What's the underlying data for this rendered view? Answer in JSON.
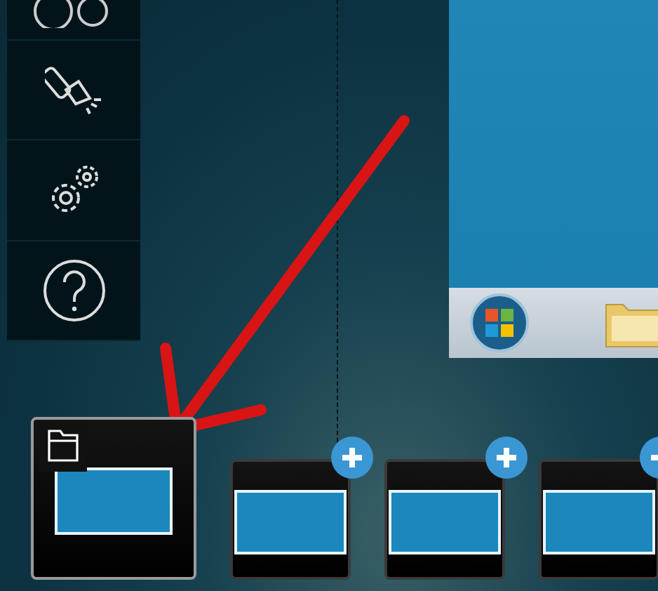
{
  "sidebar": {
    "items": [
      {
        "kind": "circles"
      },
      {
        "kind": "flashlight"
      },
      {
        "kind": "settings"
      },
      {
        "kind": "help"
      }
    ]
  },
  "preview": {
    "kind": "desktop"
  },
  "annotation": {
    "kind": "arrow"
  },
  "desktops": [
    {
      "selected": true,
      "kind": "folder"
    },
    {
      "selected": false,
      "kind": "add"
    },
    {
      "selected": false,
      "kind": "add"
    },
    {
      "selected": false,
      "kind": "add"
    }
  ]
}
